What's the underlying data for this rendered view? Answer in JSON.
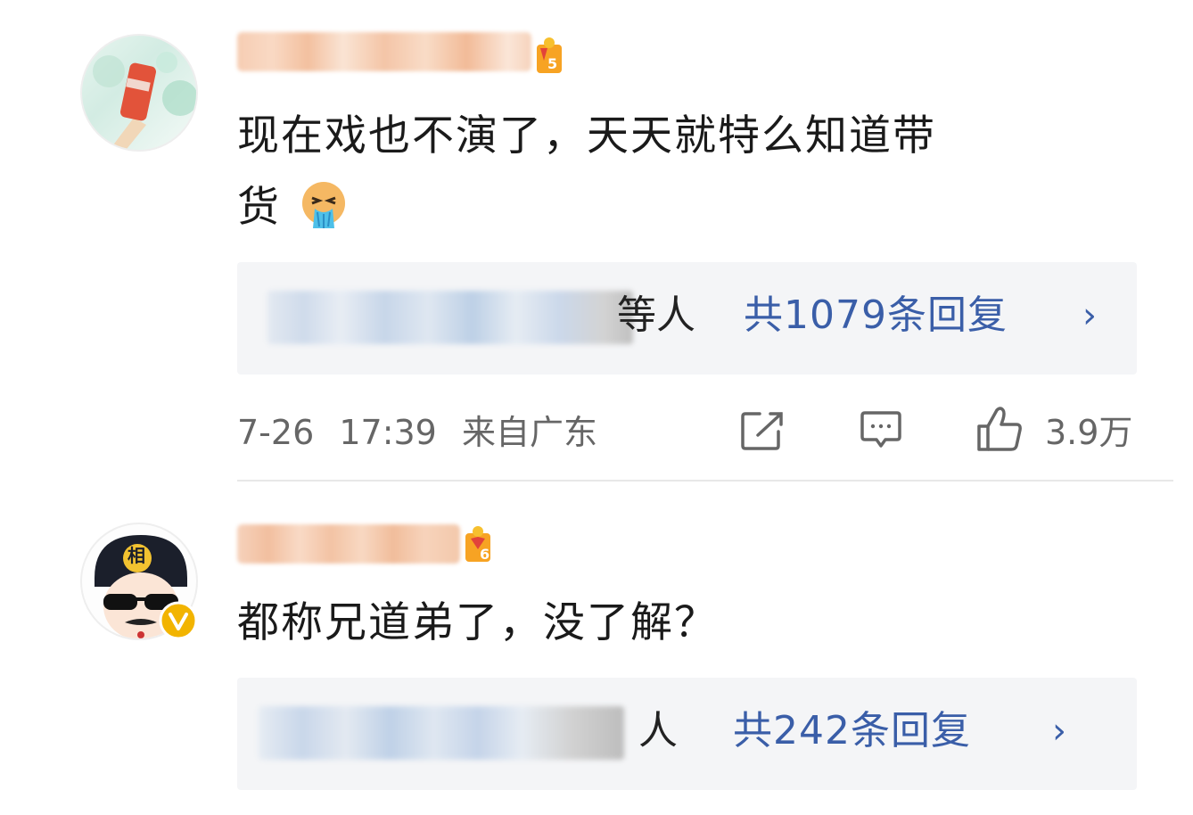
{
  "comments": [
    {
      "level": "5",
      "text_line1": "现在戏也不演了，天天就特么知道带",
      "text_line2": "货",
      "emoji": "vomit-emoji",
      "reply_people_suffix": "等人",
      "reply_count_label": "共1079条回复",
      "chevron": "›",
      "date": "7-26",
      "time": "17:39",
      "location": "来自广东",
      "likes": "3.9万"
    },
    {
      "level": "6",
      "avatar_label": "相",
      "text": "都称兄道弟了，没了解？",
      "reply_people_suffix": "人",
      "reply_count_label": "共242条回复",
      "chevron": "›"
    }
  ],
  "icons": {
    "share": "share-icon",
    "comment": "comment-icon",
    "like": "like-icon",
    "verified": "verified-badge-icon"
  },
  "colors": {
    "link_blue": "#3a5ea8",
    "reply_bg": "#f4f5f7",
    "meta_gray": "#666666",
    "verified_gold": "#f2b400"
  }
}
